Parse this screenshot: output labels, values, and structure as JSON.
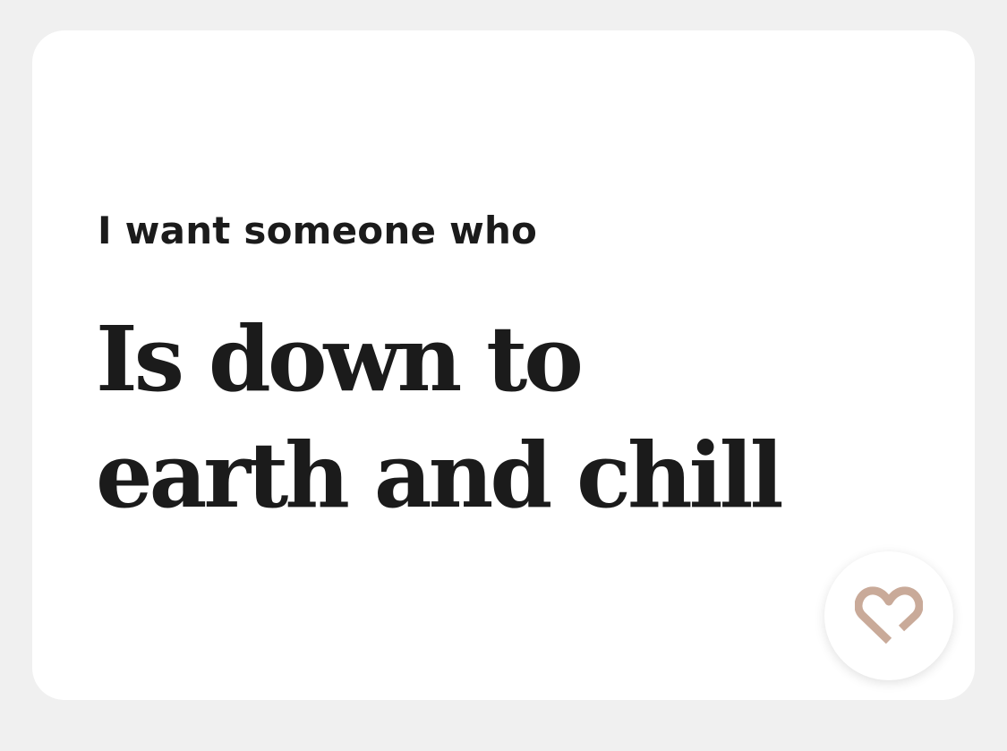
{
  "prompt": {
    "label": "I want someone who",
    "answer": "Is down to earth and chill"
  },
  "like_button": {
    "icon": "heart-icon",
    "color": "#c9aa99"
  }
}
